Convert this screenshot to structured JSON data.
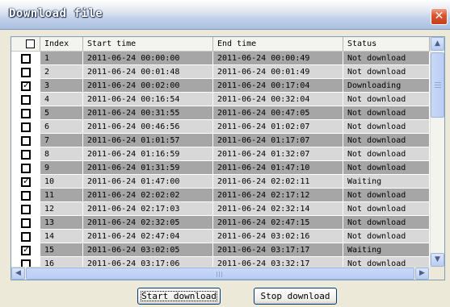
{
  "window": {
    "title": "Download file",
    "close_symbol": "✕"
  },
  "table": {
    "columns": [
      "Index",
      "Start time",
      "End time",
      "Status"
    ],
    "header_checked": false,
    "rows": [
      {
        "checked": false,
        "index": "1",
        "start": "2011-06-24 00:00:00",
        "end": "2011-06-24 00:00:49",
        "status": "Not download"
      },
      {
        "checked": false,
        "index": "2",
        "start": "2011-06-24 00:01:48",
        "end": "2011-06-24 00:01:49",
        "status": "Not download"
      },
      {
        "checked": true,
        "index": "3",
        "start": "2011-06-24 00:02:00",
        "end": "2011-06-24 00:17:04",
        "status": "Downloading"
      },
      {
        "checked": false,
        "index": "4",
        "start": "2011-06-24 00:16:54",
        "end": "2011-06-24 00:32:04",
        "status": "Not download"
      },
      {
        "checked": false,
        "index": "5",
        "start": "2011-06-24 00:31:55",
        "end": "2011-06-24 00:47:05",
        "status": "Not download"
      },
      {
        "checked": false,
        "index": "6",
        "start": "2011-06-24 00:46:56",
        "end": "2011-06-24 01:02:07",
        "status": "Not download"
      },
      {
        "checked": false,
        "index": "7",
        "start": "2011-06-24 01:01:57",
        "end": "2011-06-24 01:17:07",
        "status": "Not download"
      },
      {
        "checked": false,
        "index": "8",
        "start": "2011-06-24 01:16:59",
        "end": "2011-06-24 01:32:07",
        "status": "Not download"
      },
      {
        "checked": false,
        "index": "9",
        "start": "2011-06-24 01:31:59",
        "end": "2011-06-24 01:47:10",
        "status": "Not download"
      },
      {
        "checked": true,
        "index": "10",
        "start": "2011-06-24 01:47:00",
        "end": "2011-06-24 02:02:11",
        "status": "Waiting"
      },
      {
        "checked": false,
        "index": "11",
        "start": "2011-06-24 02:02:02",
        "end": "2011-06-24 02:17:12",
        "status": "Not download"
      },
      {
        "checked": false,
        "index": "12",
        "start": "2011-06-24 02:17:03",
        "end": "2011-06-24 02:32:14",
        "status": "Not download"
      },
      {
        "checked": false,
        "index": "13",
        "start": "2011-06-24 02:32:05",
        "end": "2011-06-24 02:47:15",
        "status": "Not download"
      },
      {
        "checked": false,
        "index": "14",
        "start": "2011-06-24 02:47:04",
        "end": "2011-06-24 03:02:16",
        "status": "Not download"
      },
      {
        "checked": true,
        "index": "15",
        "start": "2011-06-24 03:02:05",
        "end": "2011-06-24 03:17:17",
        "status": "Waiting"
      },
      {
        "checked": false,
        "index": "16",
        "start": "2011-06-24 03:17:06",
        "end": "2011-06-24 03:32:17",
        "status": "Not download"
      }
    ]
  },
  "colors": {
    "row_dark": "#a6a6a6",
    "row_light": "#d8d8d8"
  },
  "scrollbars": {
    "up_arrow": "▲",
    "down_arrow": "▼",
    "left_arrow": "◀",
    "right_arrow": "▶"
  },
  "buttons": {
    "start": "Start download",
    "stop": "Stop download"
  }
}
